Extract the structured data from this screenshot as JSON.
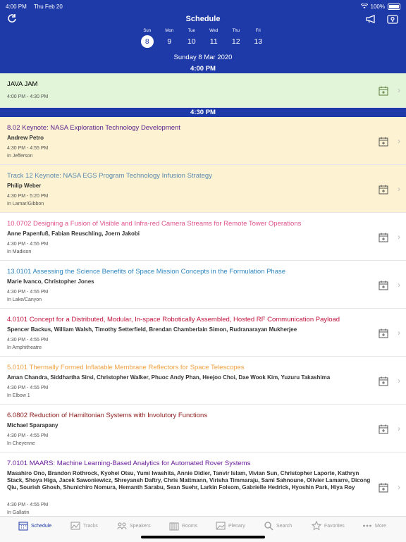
{
  "status_bar": {
    "time": "4:00 PM",
    "date": "Thu Feb 20",
    "battery": "100%"
  },
  "header": {
    "title": "Schedule",
    "days": [
      {
        "name": "Sun",
        "num": "8",
        "selected": true
      },
      {
        "name": "Mon",
        "num": "9",
        "selected": false
      },
      {
        "name": "Tue",
        "num": "10",
        "selected": false
      },
      {
        "name": "Wed",
        "num": "11",
        "selected": false
      },
      {
        "name": "Thu",
        "num": "12",
        "selected": false
      },
      {
        "name": "Fri",
        "num": "13",
        "selected": false
      }
    ],
    "selected_date": "Sunday 8 Mar 2020"
  },
  "time_headers": [
    "4:00 PM",
    "4:30 PM"
  ],
  "events": [
    {
      "title": "JAVA JAM",
      "authors": "",
      "time": "4:00 PM - 4:30 PM",
      "location": "",
      "color": "#000000",
      "bg": "#e2f5d8"
    },
    {
      "title": "8.02 Keynote: NASA Exploration Technology Development",
      "authors": "Andrew Petro",
      "time": "4:30 PM - 4:55 PM",
      "location": "In Jefferson",
      "color": "#5a1e8c",
      "bg": "#fdf3d2"
    },
    {
      "title": "Track 12 Keynote: NASA EGS Program Technology Infusion Strategy",
      "authors": "Philip Weber",
      "time": "4:30 PM - 5:20 PM",
      "location": "In Lamar/Gibbon",
      "color": "#5a8ab0",
      "bg": "#fdf3d2"
    },
    {
      "title": "10.0702 Designing a Fusion of Visible and Infra-red Camera Streams for Remote Tower Operations",
      "authors": "Anne Papenfuß, Fabian Reuschling, Joern Jakobi",
      "time": "4:30 PM - 4:55 PM",
      "location": "In Madison",
      "color": "#e0508a",
      "bg": "#ffffff"
    },
    {
      "title": "13.0101 Assessing the Science Benefits of Space Mission Concepts in the Formulation Phase",
      "authors": "Marie Ivanco, Christopher Jones",
      "time": "4:30 PM - 4:55 PM",
      "location": "In Lake/Canyon",
      "color": "#2e86c1",
      "bg": "#ffffff"
    },
    {
      "title": "4.0101 Concept for a Distributed, Modular, In-space Robotically Assembled, Hosted RF Communication Payload",
      "authors": "Spencer Backus, William Walsh, Timothy Setterfield, Brendan Chamberlain Simon, Rudranarayan Mukherjee",
      "time": "4:30 PM - 4:55 PM",
      "location": "In Amphitheatre",
      "color": "#c0143c",
      "bg": "#ffffff"
    },
    {
      "title": "5.0101 Thermally Formed Inflatable Membrane Reflectors for Space Telescopes",
      "authors": "Aman Chandra, Siddhartha Sirsi, Christopher Walker, Phuoc Andy Phan, Heejoo Choi, Dae Wook Kim, Yuzuru Takashima",
      "time": "4:30 PM - 4:55 PM",
      "location": "In Elbow 1",
      "color": "#f0a040",
      "bg": "#ffffff"
    },
    {
      "title": "6.0802 Reduction of Hamiltonian Systems with Involutory Functions",
      "authors": "Michael Sparapany",
      "time": "4:30 PM - 4:55 PM",
      "location": "In Cheyenne",
      "color": "#8b1a1a",
      "bg": "#ffffff"
    },
    {
      "title": "7.0101 MAARS: Machine Learning-Based Analytics for Automated Rover Systems",
      "authors": "Masahiro Ono, Brandon Rothrock, Kyohei Otsu, Yumi Iwashita, Annie Didier, Tanvir Islam, Vivian Sun, Christopher Laporte, Kathryn Stack, Shoya Higa, Jacek Sawoniewicz, Shreyansh Daftry, Chris Mattmann, Virisha Timmaraju, Sami Sahnoune, Olivier Lamarre, Dicong Qiu, Sourish Ghosh, Shunichiro Nomura, Hemanth Sarabu, Sean Suehr, Larkin Folsom, Gabrielle Hedrick, Hyoshin Park, Hiya Roy",
      "time": "4:30 PM - 4:55 PM",
      "location": "In Gallatin",
      "color": "#6a1b9a",
      "bg": "#ffffff"
    }
  ],
  "tabs": [
    {
      "label": "Schedule",
      "icon": "schedule-icon",
      "active": true
    },
    {
      "label": "Tracks",
      "icon": "tracks-icon",
      "active": false
    },
    {
      "label": "Speakers",
      "icon": "speakers-icon",
      "active": false
    },
    {
      "label": "Rooms",
      "icon": "rooms-icon",
      "active": false
    },
    {
      "label": "Plenary",
      "icon": "plenary-icon",
      "active": false
    },
    {
      "label": "Search",
      "icon": "search-icon",
      "active": false
    },
    {
      "label": "Favorites",
      "icon": "star-icon",
      "active": false
    },
    {
      "label": "More",
      "icon": "more-icon",
      "active": false
    }
  ]
}
